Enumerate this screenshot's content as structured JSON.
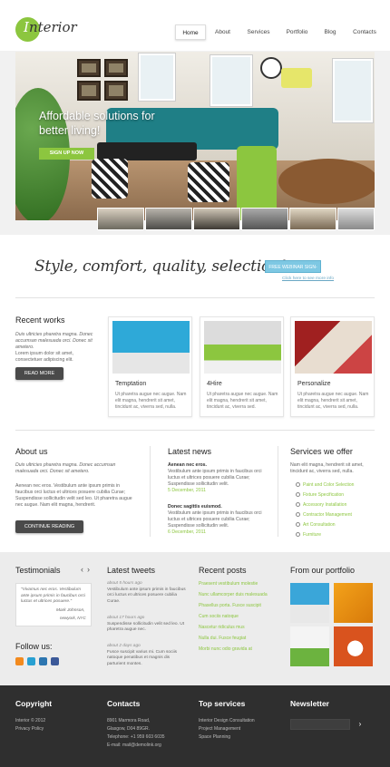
{
  "header": {
    "logo_letter": "I",
    "logo_rest": "nterior",
    "nav": [
      "Home",
      "About",
      "Services",
      "Portfolio",
      "Blog",
      "Contacts"
    ]
  },
  "hero": {
    "title": "Affordable solutions for better living!",
    "button": "SIGN UP NOW"
  },
  "slogan": {
    "text": "Style, comfort, quality, selection!",
    "button": "FREE WEBINAR SIGN-UP",
    "link": "Click here to see more info"
  },
  "recent_works": {
    "title": "Recent works",
    "intro": "Duis ultricies pharetra magna. Donec accumsan malesuada orci. Donec sit ametero.",
    "body": "Lorem ipsum dolor sit amet, consectetuer adipiscing elit.",
    "button": "READ MORE",
    "cards": [
      {
        "title": "Temptation",
        "text": "Ut pharetra augue nec augue. Nam elit magna, hendrerit sit amet, tincidunt ac, viverra sed, nulla."
      },
      {
        "title": "4Hire",
        "text": "Ut pharetra augue nec augue. Nam elit magna, hendrerit sit amet, tincidunt ac, viverra sed."
      },
      {
        "title": "Personalize",
        "text": "Ut pharetra augue nec augue. Nam elit magna, hendrerit sit amet, tincidunt ac, viverra sed, nulla."
      }
    ]
  },
  "about": {
    "title": "About us",
    "intro": "Duis ultricies pharetra magna. Donec accumsan malesuada orci. Donec sit ametero.",
    "body": "Aenean nec eros. Vestibulum ante ipsum primis in faucibus orci luctus et ultrices posuere cubilia Curae; Suspendisse sollicitudin velit sed leo. Ut pharetra augue nec augue. Nam elit magna, hendrerit.",
    "button": "CONTINUE READING"
  },
  "news": {
    "title": "Latest news",
    "items": [
      {
        "head": "Aenean nec eros.",
        "text": "Vestibulum ante ipsum primis in faucibus orci luctus et ultrices posuere cubilia Curae; Suspendisse sollicitudin velit.",
        "date": "5 December, 2011"
      },
      {
        "head": "Donec sagittis euismod.",
        "text": "Vestibulum ante ipsum primis in faucibus orci luctus et ultrices posuere cubilia Curae; Suspendisse sollicitudin velit.",
        "date": "6 December, 2011"
      }
    ]
  },
  "services": {
    "title": "Services we offer",
    "intro": "Nam elit magna, hendrerit sit amet, tincidunt ac, viverra sed, nulla.",
    "items": [
      "Paint and Color Selection",
      "Fixture Specification",
      "Accessory Installation",
      "Contractor Management",
      "Art Consultation",
      "Furniture"
    ]
  },
  "testimonials": {
    "title": "Testimonials",
    "quote": "\"Vivamus nec eros. Vestibulum ante ipsum primis in faucibus orci luctus et ultrices posuere.\"",
    "author": "Mark Johnson,",
    "place": "newyork, NYC"
  },
  "follow": {
    "title": "Follow us:"
  },
  "tweets": {
    "title": "Latest tweets",
    "items": [
      {
        "time": "about 5 hours ago",
        "text": "Vestibulum ante ipsum primis in faucibus orci luctus et ultrices posuere cubilia Curae."
      },
      {
        "time": "about 17 hours ago",
        "text": "Suspendisse sollicitudin velit sed leo. Ut pharetra augue nec."
      },
      {
        "time": "about 2 days ago",
        "text": "Fusce suscipit varius mi. Cum sociis natoque penatibus et magnis dis parturient montes."
      }
    ]
  },
  "recent_posts": {
    "title": "Recent posts",
    "items": [
      "Praesent vestibulum molestie",
      "Nunc ullamcorper duis malesuada",
      "Phasellus porta. Fusce suscipit",
      "Cum sociis natoque",
      "Nascetur ridiculus mus",
      "Nulla dui. Fusce feugiat",
      "Morbi nunc odio gravida at"
    ]
  },
  "portfolio": {
    "title": "From our portfolio"
  },
  "footer": {
    "copyright_title": "Copyright",
    "copyright_lines": [
      "Interior © 2012",
      "Privacy Policy"
    ],
    "contacts_title": "Contacts",
    "contacts_lines": [
      "8901 Marmora Road,",
      "Glasgow, D04 89GR.",
      "Telephone: +1 959 603 6035",
      "E-mail: mail@demolink.org"
    ],
    "services_title": "Top services",
    "services_lines": [
      "Interior Design Consultation",
      "Project Management",
      "Space Planning"
    ],
    "newsletter_title": "Newsletter",
    "arrow": "›"
  },
  "colors": {
    "accent": "#8cc63f",
    "dark": "#2f2f2f",
    "button_blue": "#7ec8e3"
  }
}
